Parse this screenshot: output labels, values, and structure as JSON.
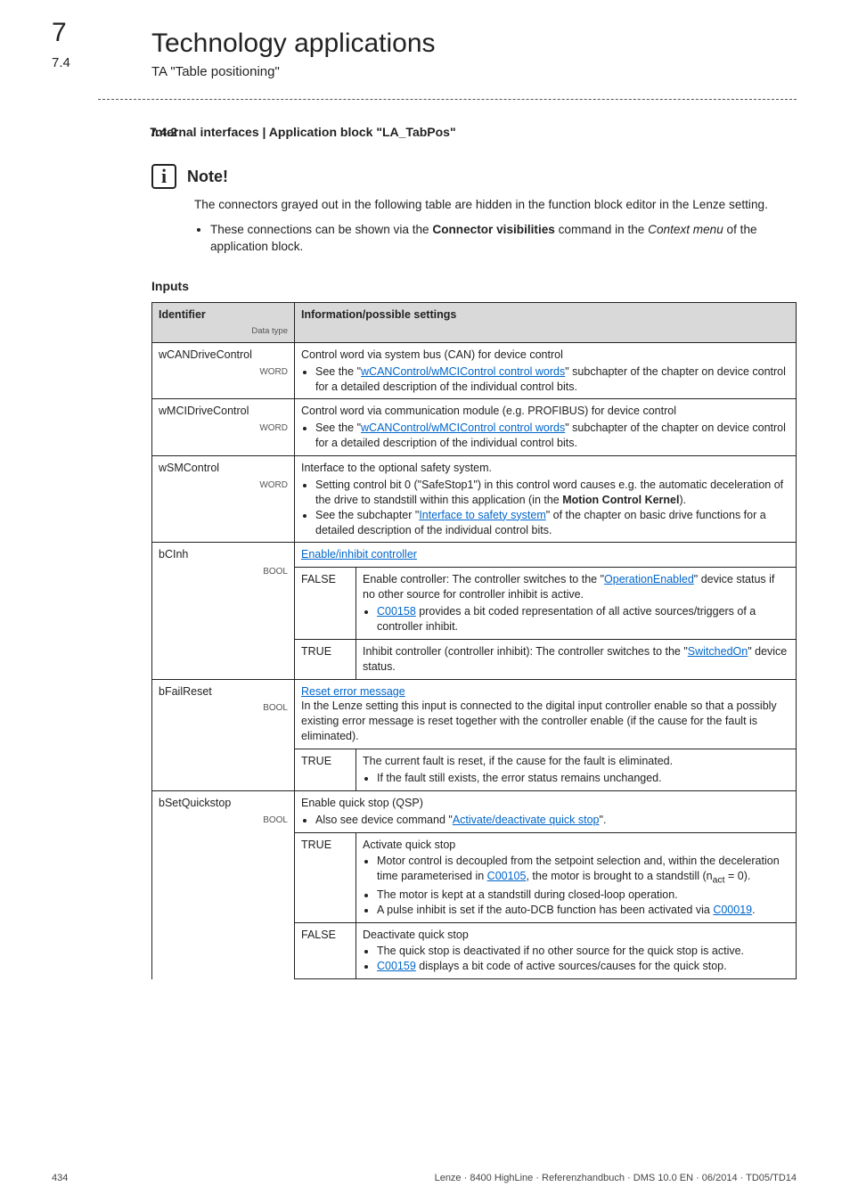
{
  "chapter": {
    "num": "7",
    "title": "Technology applications"
  },
  "sub": {
    "num": "7.4",
    "title": "TA \"Table positioning\""
  },
  "section": {
    "num": "7.4.2",
    "title": "Internal interfaces | Application block \"LA_TabPos\""
  },
  "note": {
    "label": "Note!",
    "body": "The connectors grayed out in the following table are hidden in the function block editor in the Lenze setting.",
    "bullet_pre": "These connections can be shown via the ",
    "bullet_bold": "Connector visibilities",
    "bullet_mid": " command in the ",
    "bullet_italic": "Context menu",
    "bullet_post": " of the application block."
  },
  "inputs_heading": "Inputs",
  "th": {
    "id": "Identifier",
    "dt": "Data type",
    "info": "Information/possible settings"
  },
  "rows": {
    "wCANDriveControl": {
      "id": "wCANDriveControl",
      "dt": "WORD",
      "line1": "Control word via system bus (CAN) for device control",
      "b1_a": "See the \"",
      "b1_link": "wCANControl/wMCIControl control words",
      "b1_b": "\" subchapter of the chapter on device control for a detailed description of the individual control bits."
    },
    "wMCIDriveControl": {
      "id": "wMCIDriveControl",
      "dt": "WORD",
      "line1": "Control word via communication module (e.g. PROFIBUS) for device control",
      "b1_a": "See the \"",
      "b1_link": "wCANControl/wMCIControl control words",
      "b1_b": "\" subchapter of the chapter on device control for a detailed description of the individual control bits."
    },
    "wSMControl": {
      "id": "wSMControl",
      "dt": "WORD",
      "line1": "Interface to the optional safety system.",
      "b1_a": "Setting control bit 0 (\"SafeStop1\") in this control word causes e.g. the automatic deceleration of the drive to standstill within this application (in the ",
      "b1_bold": "Motion Control Kernel",
      "b1_b": ").",
      "b2_a": "See the subchapter \"",
      "b2_link": "Interface to safety system",
      "b2_b": "\" of the chapter on basic drive functions for a detailed description of the individual control bits."
    },
    "bCInh": {
      "id": "bCInh",
      "dt": "BOOL",
      "headlink": "Enable/inhibit controller",
      "false": {
        "v": "FALSE",
        "d1_a": "Enable controller: The controller switches to the \"",
        "d1_link": "OperationEnabled",
        "d1_b": "\" device status if no other source for controller inhibit is active.",
        "d2_link": "C00158",
        "d2_b": " provides a bit coded representation of all active sources/triggers of a controller inhibit."
      },
      "true": {
        "v": "TRUE",
        "d1_a": "Inhibit controller (controller inhibit): The controller switches to the \"",
        "d1_link": "SwitchedOn",
        "d1_b": "\" device status."
      }
    },
    "bFailReset": {
      "id": "bFailReset",
      "dt": "BOOL",
      "headlink": "Reset error message",
      "desc": "In the Lenze setting this input is connected to the digital input controller enable so that a possibly existing error message is reset together with the controller enable (if the cause for the fault is eliminated).",
      "true": {
        "v": "TRUE",
        "d1": "The current fault is reset, if the cause for the fault is eliminated.",
        "d2": "If the fault still exists, the error status remains unchanged."
      }
    },
    "bSetQuickstop": {
      "id": "bSetQuickstop",
      "dt": "BOOL",
      "line1": "Enable quick stop (QSP)",
      "b1_a": "Also see device command \"",
      "b1_link": "Activate/deactivate quick stop",
      "b1_b": "\".",
      "true": {
        "v": "TRUE",
        "d1": "Activate quick stop",
        "d2": "Motor control is decoupled from the setpoint selection and, within the deceleration time parameterised in ",
        "d2_link": "C00105",
        "d2_b": ", the motor is brought to a standstill (n",
        "d2_sub": "act",
        "d2_c": " = 0).",
        "d3": "The motor is kept at a standstill during closed-loop operation.",
        "d4": "A pulse inhibit is set if the auto-DCB function has been activated via ",
        "d4_link": "C00019",
        "d4_b": "."
      },
      "false": {
        "v": "FALSE",
        "d1": "Deactivate quick stop",
        "d2": "The quick stop is deactivated if no other source for the quick stop is active.",
        "d3_link": "C00159",
        "d3_b": " displays a bit code of active sources/causes for the quick stop."
      }
    }
  },
  "footer": {
    "page": "434",
    "right": "Lenze · 8400 HighLine · Referenzhandbuch · DMS 10.0 EN · 06/2014 · TD05/TD14"
  }
}
